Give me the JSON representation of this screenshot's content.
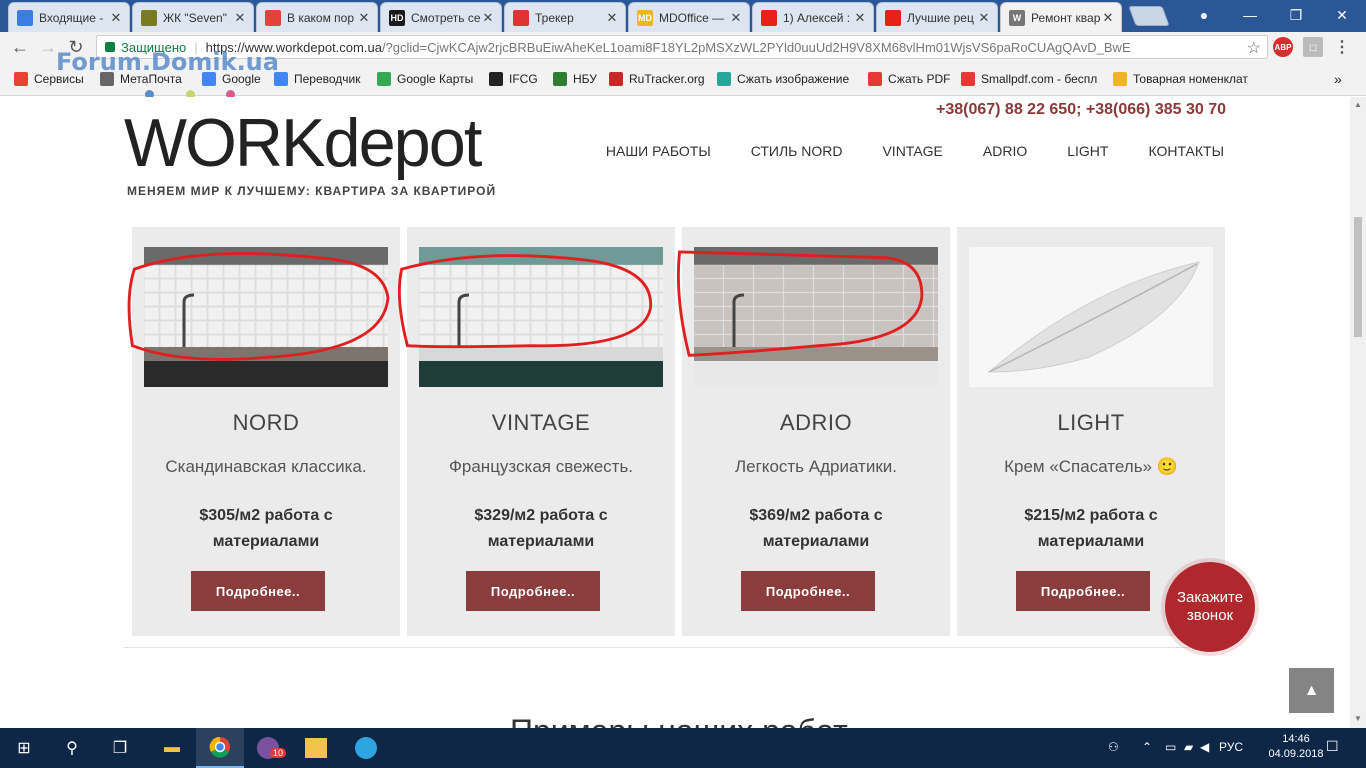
{
  "browser": {
    "tabs": [
      {
        "label": "Входящие -",
        "icon_color": "#3b7de0",
        "icon": "envelope-icon"
      },
      {
        "label": "ЖК \"Seven\"",
        "icon_color": "#7a7a1e",
        "icon": "building-icon"
      },
      {
        "label": "В каком пор",
        "icon_color": "#e0433b",
        "icon": "hexagon-icon"
      },
      {
        "label": "Смотреть се",
        "icon_text": "HD",
        "icon_color": "#1a1a1a",
        "icon": "hd-icon"
      },
      {
        "label": "Трекер",
        "icon_color": "#d33",
        "icon": "tracker-icon"
      },
      {
        "label": "MDOffice —",
        "icon_text": "MD",
        "icon_color": "#f0b429",
        "icon": "mdoffice-icon"
      },
      {
        "label": "1) Алексей :",
        "icon_color": "#e62117",
        "icon": "youtube-icon"
      },
      {
        "label": "Лучшие рец",
        "icon_color": "#e62117",
        "icon": "youtube-icon"
      },
      {
        "label": "Ремонт квар",
        "icon_text": "W",
        "icon_color": "#777777",
        "icon": "workdepot-icon",
        "active": true
      }
    ],
    "address": {
      "secure_label": "Защищено",
      "url_host": "https://www.workdepot.com.ua",
      "url_rest": "/?gclid=CjwKCAjw2rjcBRBuEiwAheKeL1oami8F18YL2pMSXzWL2PYld0uuUd2H9V8XM68vlHm01WjsVS6paRoCUAgQAvD_BwE"
    },
    "bookmarks": [
      {
        "label": "Сервисы",
        "icon_color": "#e94235"
      },
      {
        "label": "МетаПочта",
        "icon_color": "#666666"
      },
      {
        "label": "Google",
        "icon_color": "#4285f4"
      },
      {
        "label": "Переводчик",
        "icon_color": "#4285f4"
      },
      {
        "label": "Google Карты",
        "icon_color": "#34a853"
      },
      {
        "label": "IFCG",
        "icon_color": "#222222"
      },
      {
        "label": "НБУ",
        "icon_color": "#2e7d32"
      },
      {
        "label": "RuTracker.org",
        "icon_color": "#c62828"
      },
      {
        "label": "Сжать изображение",
        "icon_color": "#26a69a"
      },
      {
        "label": "Сжать PDF",
        "icon_color": "#e53935"
      },
      {
        "label": "Smallpdf.com - беспл",
        "icon_color": "#e53935"
      },
      {
        "label": "Товарная номенклат",
        "icon_color": "#f0b429"
      }
    ],
    "bookmarks_more": "»",
    "watermark": "Forum.Domik.ua"
  },
  "site": {
    "phones": "+38(067) 88 22 650; +38(066) 385 30 70",
    "logo_text": "WORKdepot",
    "tagline": "МЕНЯЕМ МИР К ЛУЧШЕМУ: КВАРТИРА ЗА КВАРТИРОЙ",
    "nav": [
      "НАШИ РАБОТЫ",
      "СТИЛЬ NORD",
      "VINTAGE",
      "ADRIO",
      "LIGHT",
      "КОНТАКТЫ"
    ],
    "cards": [
      {
        "name": "NORD",
        "desc": "Скандинавская классика.",
        "price": "$305/м2 работа с материалами",
        "button": "Подробнее..",
        "image": "nord-kitchen"
      },
      {
        "name": "VINTAGE",
        "desc": "Французская свежесть.",
        "price": "$329/м2 работа с материалами",
        "button": "Подробнее..",
        "image": "vintage-kitchen"
      },
      {
        "name": "ADRIO",
        "desc": "Легкость Адриатики.",
        "price": "$369/м2 работа с материалами",
        "button": "Подробнее..",
        "image": "adrio-kitchen"
      },
      {
        "name": "LIGHT",
        "desc": "Крем «Спасатель» 🙂",
        "price": "$215/м2 работа с материалами",
        "button": "Подробнее..",
        "image": "feather"
      }
    ],
    "callback_button": "Закажите звонок",
    "section_heading_partial": "Примеры наших работ"
  },
  "taskbar": {
    "language": "РУС",
    "time": "14:46",
    "date": "04.09.2018",
    "viber_badge": "10"
  },
  "colors": {
    "accent": "#8b3d3d",
    "callback": "#b0282d",
    "annotation": "#e02020"
  }
}
